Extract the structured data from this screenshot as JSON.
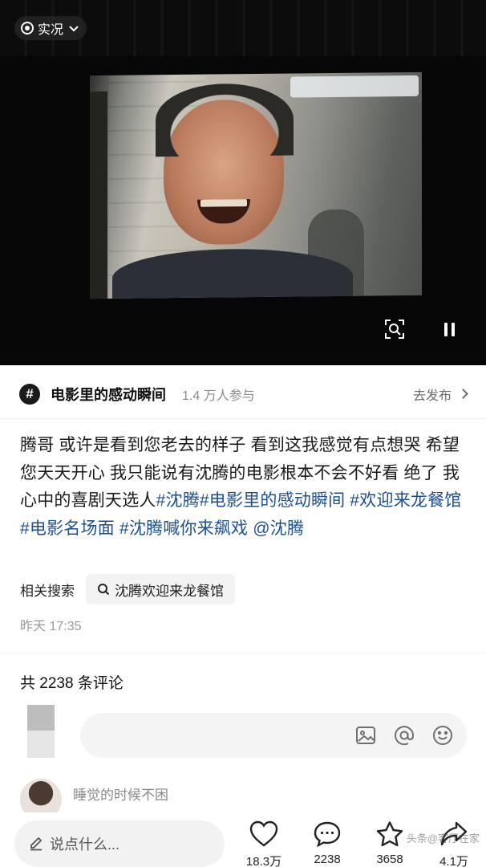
{
  "video": {
    "live_label": "实况",
    "live_icon": "live-photo-icon",
    "scan_icon": "scan-icon",
    "pause_icon": "pause-icon"
  },
  "topic": {
    "icon_glyph": "#",
    "title": "电影里的感动瞬间",
    "participants": "1.4 万人参与",
    "publish_label": "去发布"
  },
  "caption": {
    "text": "腾哥  或许是看到您老去的样子 看到这我感觉有点想哭 希望您天天开心 我只能说有沈腾的电影根本不会不好看 绝了 我心中的喜剧天选人",
    "tags": [
      "#沈腾",
      "#电影里的感动瞬间",
      "#欢迎来龙餐馆",
      "#电影名场面",
      "#沈腾喊你来飙戏",
      "@沈腾"
    ]
  },
  "related": {
    "label": "相关搜索",
    "chip": "沈腾欢迎来龙餐馆"
  },
  "timestamp": "昨天 17:35",
  "comments": {
    "count_label": "共 2238 条评论",
    "first_commenter": "睡觉的时候不困"
  },
  "bottom_bar": {
    "input_placeholder": "说点什么...",
    "likes": "18.3万",
    "comments": "2238",
    "favorites": "3658",
    "shares": "4.1万"
  },
  "watermark": "头条@客厅在家",
  "colors": {
    "link": "#1e4f8f",
    "video_bg": "#070707"
  }
}
